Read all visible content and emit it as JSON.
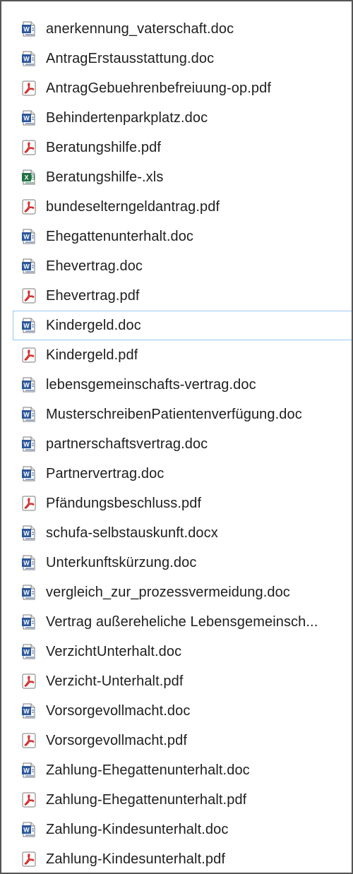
{
  "colors": {
    "word": "#2b579a",
    "pdf": "#d32f2f",
    "excel": "#217346",
    "focus_border": "#99c9ef"
  },
  "files": [
    {
      "name": "anerkennung_vaterschaft.doc",
      "icon": "word-document-icon",
      "type": "word"
    },
    {
      "name": "AntragErstausstattung.doc",
      "icon": "word-document-icon",
      "type": "word"
    },
    {
      "name": "AntragGebuehrenbefreiuung-op.pdf",
      "icon": "pdf-document-icon",
      "type": "pdf"
    },
    {
      "name": "Behindertenparkplatz.doc",
      "icon": "word-document-icon",
      "type": "word"
    },
    {
      "name": "Beratungshilfe.pdf",
      "icon": "pdf-document-icon",
      "type": "pdf"
    },
    {
      "name": "Beratungshilfe-.xls",
      "icon": "excel-spreadsheet-icon",
      "type": "excel"
    },
    {
      "name": "bundeselterngeldantrag.pdf",
      "icon": "pdf-document-icon",
      "type": "pdf"
    },
    {
      "name": "Ehegattenunterhalt.doc",
      "icon": "word-document-icon",
      "type": "word"
    },
    {
      "name": "Ehevertrag.doc",
      "icon": "word-document-icon",
      "type": "word"
    },
    {
      "name": "Ehevertrag.pdf",
      "icon": "pdf-document-icon",
      "type": "pdf"
    },
    {
      "name": "Kindergeld.doc",
      "icon": "word-document-icon",
      "type": "word",
      "focused": true
    },
    {
      "name": "Kindergeld.pdf",
      "icon": "pdf-document-icon",
      "type": "pdf"
    },
    {
      "name": "lebensgemeinschafts-vertrag.doc",
      "icon": "word-document-icon",
      "type": "word"
    },
    {
      "name": "MusterschreibenPatientenverfügung.doc",
      "icon": "word-document-icon",
      "type": "word"
    },
    {
      "name": "partnerschaftsvertrag.doc",
      "icon": "word-document-icon",
      "type": "word"
    },
    {
      "name": "Partnervertrag.doc",
      "icon": "word-document-icon",
      "type": "word"
    },
    {
      "name": "Pfändungsbeschluss.pdf",
      "icon": "pdf-document-icon",
      "type": "pdf"
    },
    {
      "name": "schufa-selbstauskunft.docx",
      "icon": "word-document-icon",
      "type": "word"
    },
    {
      "name": "Unterkunftskürzung.doc",
      "icon": "word-document-icon",
      "type": "word"
    },
    {
      "name": "vergleich_zur_prozessvermeidung.doc",
      "icon": "word-document-icon",
      "type": "word"
    },
    {
      "name": "Vertrag außereheliche Lebensgemeinsch...",
      "icon": "word-document-icon",
      "type": "word"
    },
    {
      "name": "VerzichtUnterhalt.doc",
      "icon": "word-document-icon",
      "type": "word"
    },
    {
      "name": "Verzicht-Unterhalt.pdf",
      "icon": "pdf-document-icon",
      "type": "pdf"
    },
    {
      "name": "Vorsorgevollmacht.doc",
      "icon": "word-document-icon",
      "type": "word"
    },
    {
      "name": "Vorsorgevollmacht.pdf",
      "icon": "pdf-document-icon",
      "type": "pdf"
    },
    {
      "name": "Zahlung-Ehegattenunterhalt.doc",
      "icon": "word-document-icon",
      "type": "word"
    },
    {
      "name": "Zahlung-Ehegattenunterhalt.pdf",
      "icon": "pdf-document-icon",
      "type": "pdf"
    },
    {
      "name": "Zahlung-Kindesunterhalt.doc",
      "icon": "word-document-icon",
      "type": "word"
    },
    {
      "name": "Zahlung-Kindesunterhalt.pdf",
      "icon": "pdf-document-icon",
      "type": "pdf"
    }
  ]
}
